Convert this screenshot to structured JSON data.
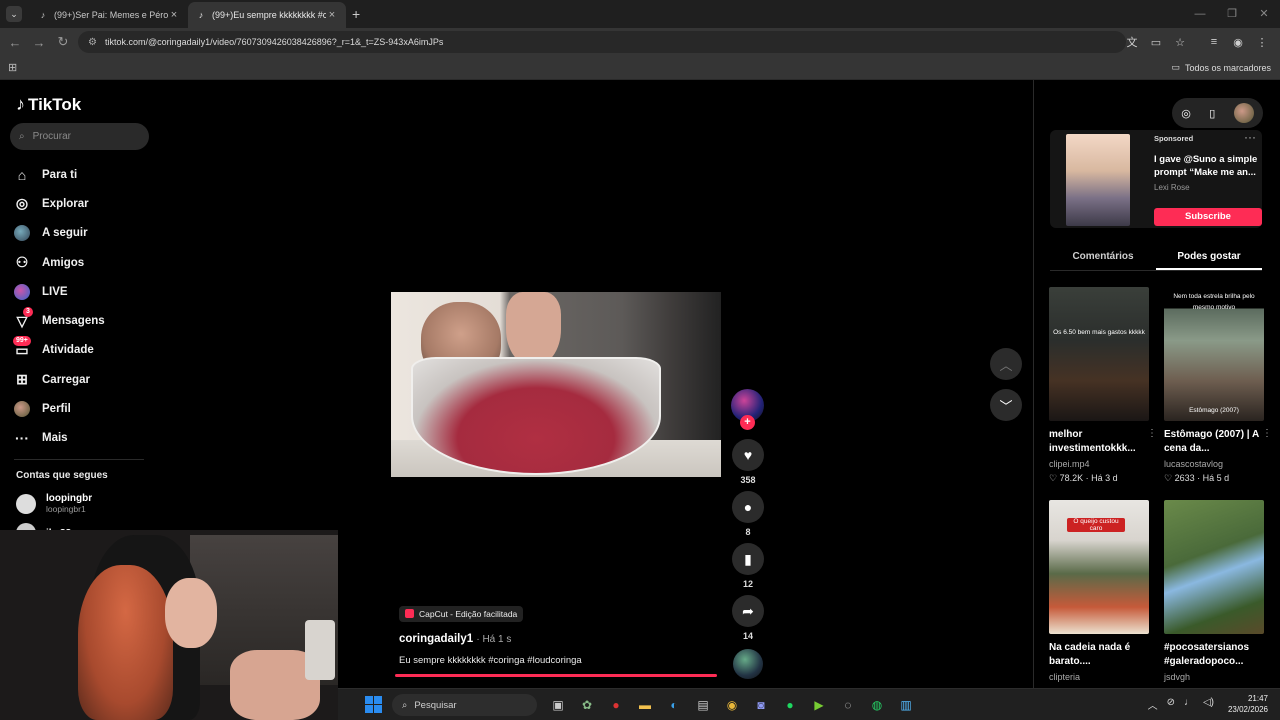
{
  "browser": {
    "tabs": [
      {
        "title": "(99+)Ser Pai: Memes e Pérolas",
        "active": false
      },
      {
        "title": "(99+)Eu sempre kkkkkkkk #cori",
        "active": true
      }
    ],
    "url": "tiktok.com/@coringadaily1/video/7607309426038426896?_r=1&_t=ZS-943xA6imJPs",
    "bookmarks_all": "Todos os marcadores"
  },
  "sidebar": {
    "logo": "TikTok",
    "search_placeholder": "Procurar",
    "items": [
      {
        "label": "Para ti",
        "icon": "home-icon"
      },
      {
        "label": "Explorar",
        "icon": "compass-icon"
      },
      {
        "label": "A seguir",
        "icon": "following-avatar-icon"
      },
      {
        "label": "Amigos",
        "icon": "friends-icon"
      },
      {
        "label": "LIVE",
        "icon": "live-icon"
      },
      {
        "label": "Mensagens",
        "icon": "messages-icon",
        "badge": "3"
      },
      {
        "label": "Atividade",
        "icon": "activity-icon",
        "badge": "99+"
      },
      {
        "label": "Carregar",
        "icon": "upload-icon"
      },
      {
        "label": "Perfil",
        "icon": "profile-avatar-icon"
      },
      {
        "label": "Mais",
        "icon": "more-icon"
      }
    ],
    "following_header": "Contas que segues",
    "following": [
      {
        "name": "loopingbr",
        "handle": "loopingbr1"
      },
      {
        "name": "jke88",
        "handle": ""
      }
    ]
  },
  "video": {
    "effect": "CapCut - Edição facilitada",
    "author": "coringadaily1",
    "time": "· Há 1 s",
    "description": "Eu sempre kkkkkkkk #coringa #loudcoringa",
    "likes": "358",
    "comments": "8",
    "saves": "12",
    "shares": "14",
    "progress": 1.0
  },
  "right_panel": {
    "ad": {
      "sponsored": "Sponsored",
      "title": "I gave @Suno a simple prompt “Make me an...",
      "author": "Lexi Rose",
      "cta": "Subscribe"
    },
    "tabs": [
      "Comentários",
      "Podes gostar"
    ],
    "active_tab": "Podes gostar",
    "cards": [
      {
        "overlay": "Os 6.50 bem mais gastos kkkkk",
        "title": "melhor investimentokkk...",
        "author": "clipei.mp4",
        "likes": "78.2K",
        "age": "Há 3 d"
      },
      {
        "overlay": "Nem toda estrela brilha pelo mesmo motivo",
        "sub": "Estômago (2007)",
        "title": "Estômago (2007) | A cena da...",
        "author": "lucascostavlog",
        "likes": "2633",
        "age": "Há 5 d"
      },
      {
        "overlay": "O queijo custou caro",
        "title": "Na cadeia nada é barato....",
        "author": "clipteria",
        "likes": "",
        "age": ""
      },
      {
        "overlay": "",
        "title": "#pocosatersianos #galeradopoco...",
        "author": "jsdvgh",
        "likes": "",
        "age": ""
      }
    ]
  },
  "taskbar": {
    "search": "Pesquisar",
    "time": "21:47",
    "date": "23/02/2026"
  }
}
